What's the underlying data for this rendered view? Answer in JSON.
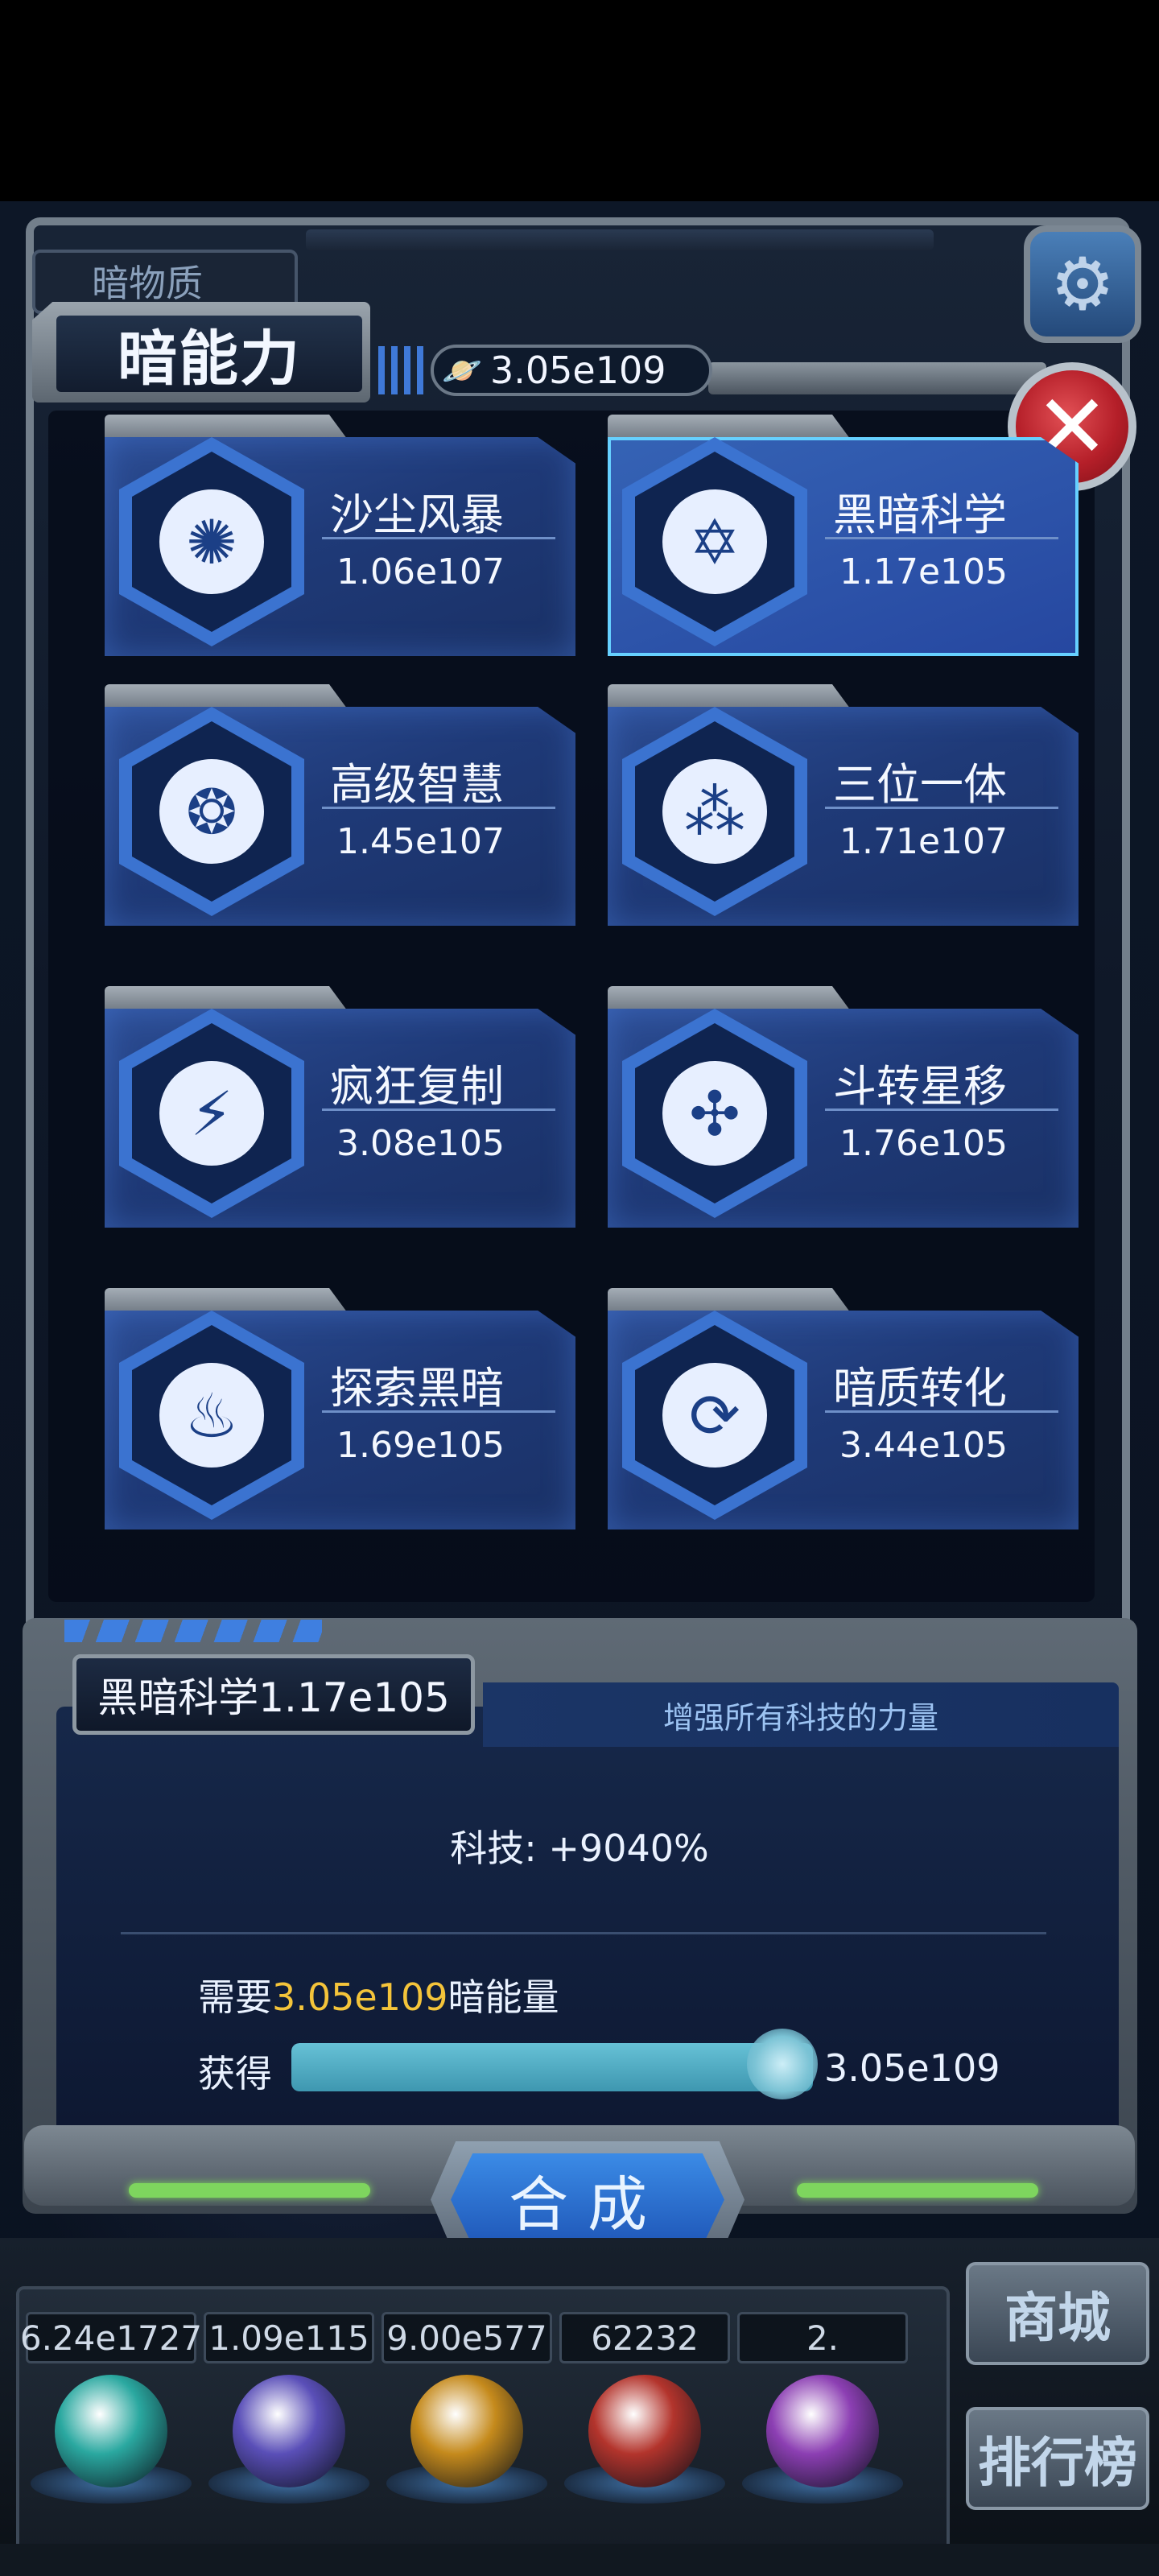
{
  "header": {
    "back_tab_label": "暗物质",
    "title": "暗能力",
    "energy_value": "3.05e109",
    "settings_icon": "gear-icon",
    "close_icon": "close-icon"
  },
  "skills": [
    {
      "name": "沙尘风暴",
      "value": "1.06e107",
      "icon": "sandstorm-icon",
      "glyph": "✺"
    },
    {
      "name": "黑暗科学",
      "value": "1.17e105",
      "icon": "hexagram-eye-icon",
      "glyph": "✡",
      "selected": true
    },
    {
      "name": "高级智慧",
      "value": "1.45e107",
      "icon": "brain-icon",
      "glyph": "❂"
    },
    {
      "name": "三位一体",
      "value": "1.71e107",
      "icon": "trinity-circles-icon",
      "glyph": "⁂"
    },
    {
      "name": "疯狂复制",
      "value": "3.08e105",
      "icon": "lightning-expand-icon",
      "glyph": "⚡"
    },
    {
      "name": "斗转星移",
      "value": "1.76e105",
      "icon": "vortex-icon",
      "glyph": "✣"
    },
    {
      "name": "探索黑暗",
      "value": "1.69e105",
      "icon": "lantern-icon",
      "glyph": "♨"
    },
    {
      "name": "暗质转化",
      "value": "3.44e105",
      "icon": "cycle-arrows-icon",
      "glyph": "⟳"
    }
  ],
  "detail": {
    "title": "黑暗科学1.17e105",
    "description": "增强所有科技的力量",
    "effect": "科技: +9040%",
    "need_prefix": "需要",
    "need_amount": "3.05e109",
    "need_suffix": "暗能量",
    "gain_label": "获得",
    "gain_value": "3.05e109",
    "gain_progress": 1.0,
    "synth_button": "合成"
  },
  "resources": [
    {
      "value": "6.24e1727",
      "color": "#2aa8a0"
    },
    {
      "value": "1.09e115",
      "color": "#5a4fb8"
    },
    {
      "value": "9.00e577",
      "color": "#c58a1c"
    },
    {
      "value": "62232",
      "color": "#b3342c"
    },
    {
      "value": "2.",
      "color": "#8c3fb3"
    }
  ],
  "side_buttons": {
    "shop": "商城",
    "leaderboard": "排行榜"
  },
  "colors": {
    "accent": "#3b73d0",
    "highlight": "#f4c43a",
    "progress": "#4fa9c2",
    "close": "#c0262f"
  }
}
